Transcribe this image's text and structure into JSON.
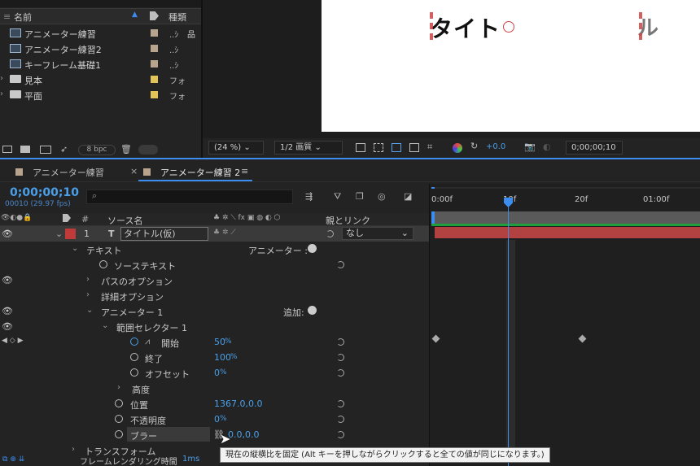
{
  "project": {
    "col_name": "名前",
    "col_type": "種類",
    "items": [
      {
        "name": "アニメーター練習",
        "type": "..ｼ",
        "color": "#b8a48c",
        "kind": "comp"
      },
      {
        "name": "アニメーター練習2",
        "type": "..ｼ",
        "color": "#b8a48c",
        "kind": "comp"
      },
      {
        "name": "キーフレーム基礎1",
        "type": "..ｼ",
        "color": "#b8a48c",
        "kind": "comp"
      },
      {
        "name": "見本",
        "type": "フォ",
        "color": "#e2c35a",
        "kind": "folder"
      },
      {
        "name": "平面",
        "type": "フォ",
        "color": "#e2c35a",
        "kind": "folder"
      }
    ],
    "bpc": "8 bpc"
  },
  "viewer": {
    "canvas_text_left": "タイト",
    "canvas_text_right": "ル",
    "zoom": "(24 %)",
    "resolution": "1/2 画質",
    "exposure": "+0.0",
    "timecode": "0;00;00;10"
  },
  "timeline": {
    "tabs": [
      "アニメーター練習",
      "アニメーター練習 2"
    ],
    "current_time": "0;00;00;10",
    "fps_label": "00010 (29.97 fps)",
    "col_hash": "#",
    "col_source": "ソース名",
    "col_parent": "親とリンク",
    "layer": {
      "num": "1",
      "type_icon": "T",
      "name": "タイトル(仮)",
      "parent": "なし"
    },
    "rows": {
      "text_group": "テキスト",
      "animator_menu": "アニメーター :",
      "source_text": "ソーステキスト",
      "path_options": "パスのオプション",
      "more_options": "詳細オプション",
      "animator1": "アニメーター 1",
      "add_label": "追加:",
      "range_selector": "範囲セレクター 1",
      "start": "開始",
      "start_val": "50",
      "end": "終了",
      "end_val": "100",
      "offset": "オフセット",
      "offset_val": "0",
      "advanced": "高度",
      "position": "位置",
      "position_val": "1367.0,0.0",
      "opacity": "不透明度",
      "opacity_val": "0",
      "blur": "ブラー",
      "blur_val": "0.0,0.0",
      "transform": "トランスフォーム",
      "percent": "%"
    },
    "ruler": [
      "0:00f",
      "10f",
      "20f",
      "01:00f"
    ],
    "status": "フレームレンダリング時間",
    "status_val": "1ms"
  },
  "tooltip": "現在の縦横比を固定 (Alt キーを押しながらクリックすると全ての値が同じになります。)",
  "colors": {
    "accent": "#3d8df0",
    "layer_red": "#b24242",
    "work_green": "#1e9e3c"
  }
}
